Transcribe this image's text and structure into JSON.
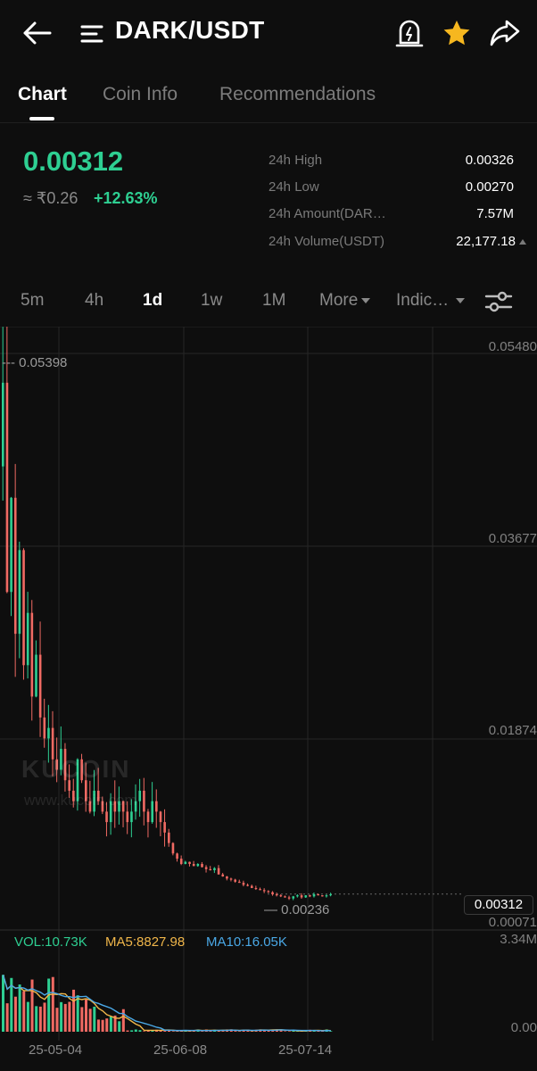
{
  "header": {
    "title": "DARK/USDT"
  },
  "tabs": [
    {
      "label": "Chart",
      "active": true
    },
    {
      "label": "Coin Info",
      "active": false
    },
    {
      "label": "Recommendations",
      "active": false
    }
  ],
  "ticker": {
    "price": "0.00312",
    "fiat": "≈ ₹0.26",
    "change": "+12.63%",
    "stats": [
      {
        "label": "24h High",
        "value": "0.00326"
      },
      {
        "label": "24h Low",
        "value": "0.00270"
      },
      {
        "label": "24h Amount(DAR…",
        "value": "7.57M"
      },
      {
        "label": "24h Volume(USDT)",
        "value": "22,177.18"
      }
    ]
  },
  "intervals": {
    "items": [
      "5m",
      "4h",
      "1d",
      "1w",
      "1M"
    ],
    "active": "1d",
    "more_label": "More",
    "indicators_label": "Indic…"
  },
  "chart": {
    "y_axis_labels": [
      "0.05480",
      "0.03677",
      "0.01874",
      "0.00071"
    ],
    "current_price_label": "0.00312",
    "high_marker_label": "0.05398",
    "low_marker_label": "0.00236",
    "volume_max_label": "3.34M",
    "volume_min_label": "0.00",
    "x_axis_labels": [
      "25-05-04",
      "25-06-08",
      "25-07-14"
    ],
    "watermark": "KUCOIN",
    "watermark_url": "www.kucoin.com",
    "volume_legend": {
      "vol": "VOL:10.73K",
      "ma5": "MA5:8827.98",
      "ma10": "MA10:16.05K"
    },
    "colors": {
      "up": "#2ecf92",
      "down": "#f06a63",
      "ma5": "#f0b64a",
      "ma10": "#4aa8e6",
      "vol_legend": "#2ecf92"
    }
  },
  "chart_data": {
    "type": "candlestick",
    "interval": "1d",
    "x_ticks": [
      "25-05-04",
      "25-06-08",
      "25-07-14"
    ],
    "ylim": [
      0.00071,
      0.0548
    ],
    "y_ticks": [
      0.0548,
      0.03677,
      0.01874,
      0.00071
    ],
    "period_high": 0.05398,
    "period_low": 0.00236,
    "last_price": 0.00312,
    "close_series_approx": [
      0.052,
      0.032,
      0.041,
      0.028,
      0.036,
      0.025,
      0.03,
      0.022,
      0.026,
      0.02,
      0.018,
      0.019,
      0.016,
      0.015,
      0.017,
      0.014,
      0.013,
      0.012,
      0.016,
      0.014,
      0.012,
      0.011,
      0.013,
      0.012,
      0.011,
      0.01,
      0.012,
      0.011,
      0.012,
      0.011,
      0.01,
      0.011,
      0.012,
      0.013,
      0.011,
      0.01,
      0.012,
      0.011,
      0.01,
      0.009,
      0.008,
      0.007,
      0.0065,
      0.006,
      0.0062,
      0.006,
      0.0058,
      0.006,
      0.0057,
      0.0055,
      0.0054,
      0.0056,
      0.005,
      0.0048,
      0.0046,
      0.0045,
      0.0043,
      0.0042,
      0.004,
      0.0039,
      0.0037,
      0.0036,
      0.0035,
      0.0034,
      0.0033,
      0.0031,
      0.003,
      0.0029,
      0.0028,
      0.0027,
      0.0029,
      0.003,
      0.0028,
      0.003,
      0.0029,
      0.0031,
      0.003,
      0.0029,
      0.003,
      0.0031
    ],
    "volume_ylim": [
      0,
      3340000
    ],
    "volume_last": 10730,
    "ma5_last": 8827.98,
    "ma10_last": 16050
  }
}
